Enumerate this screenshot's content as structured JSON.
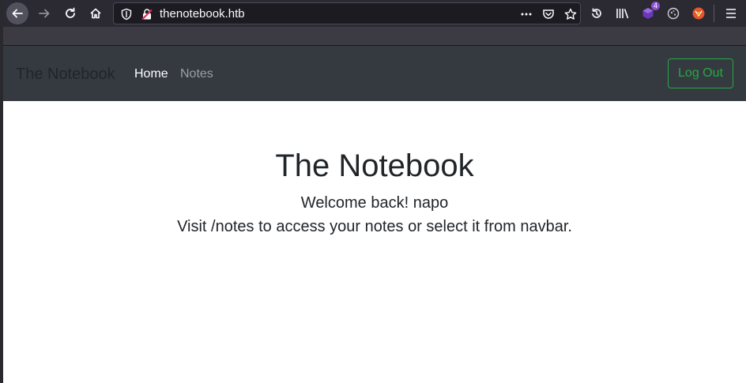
{
  "browser": {
    "url": "thenotebook.htb",
    "extension_badge": "4",
    "colors": {
      "toolbar": "#2b2a33",
      "urlbar": "#1c1b22"
    }
  },
  "site": {
    "brand": "The Notebook",
    "nav": {
      "home": "Home",
      "notes": "Notes"
    },
    "logout": "Log Out",
    "colors": {
      "navbar": "#343a40",
      "success": "#28a745"
    }
  },
  "main": {
    "title": "The Notebook",
    "welcome": "Welcome back! napo",
    "visit": "Visit /notes to access your notes or select it from navbar."
  }
}
